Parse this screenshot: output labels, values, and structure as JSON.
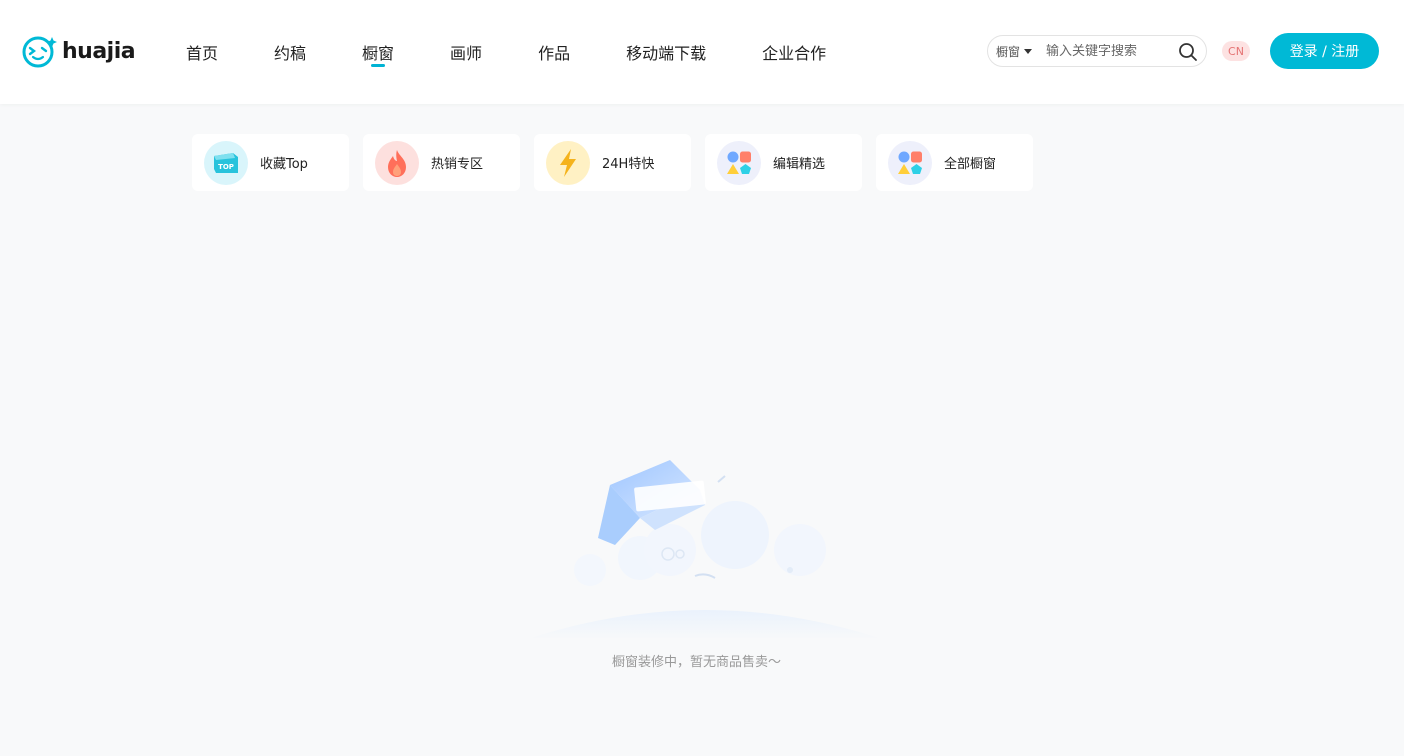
{
  "header": {
    "logo_text": "huajia",
    "nav": [
      {
        "label": "首页",
        "active": false
      },
      {
        "label": "约稿",
        "active": false
      },
      {
        "label": "橱窗",
        "active": true
      },
      {
        "label": "画师",
        "active": false
      },
      {
        "label": "作品",
        "active": false
      },
      {
        "label": "移动端下载",
        "active": false
      },
      {
        "label": "企业合作",
        "active": false
      }
    ],
    "search": {
      "scope": "橱窗",
      "placeholder": "输入关键字搜索"
    },
    "language": "CN",
    "login_label": "登录 / 注册"
  },
  "categories": [
    {
      "label": "收藏Top",
      "icon": "top-box-icon"
    },
    {
      "label": "热销专区",
      "icon": "flame-icon"
    },
    {
      "label": "24H特快",
      "icon": "lightning-icon"
    },
    {
      "label": "编辑精选",
      "icon": "shapes-icon"
    },
    {
      "label": "全部橱窗",
      "icon": "shapes-icon"
    }
  ],
  "empty_state": {
    "message": "橱窗装修中，暂无商品售卖～"
  },
  "colors": {
    "accent": "#00b9d6",
    "background": "#f8f9fa",
    "lang_badge_bg": "#fde2e2"
  }
}
